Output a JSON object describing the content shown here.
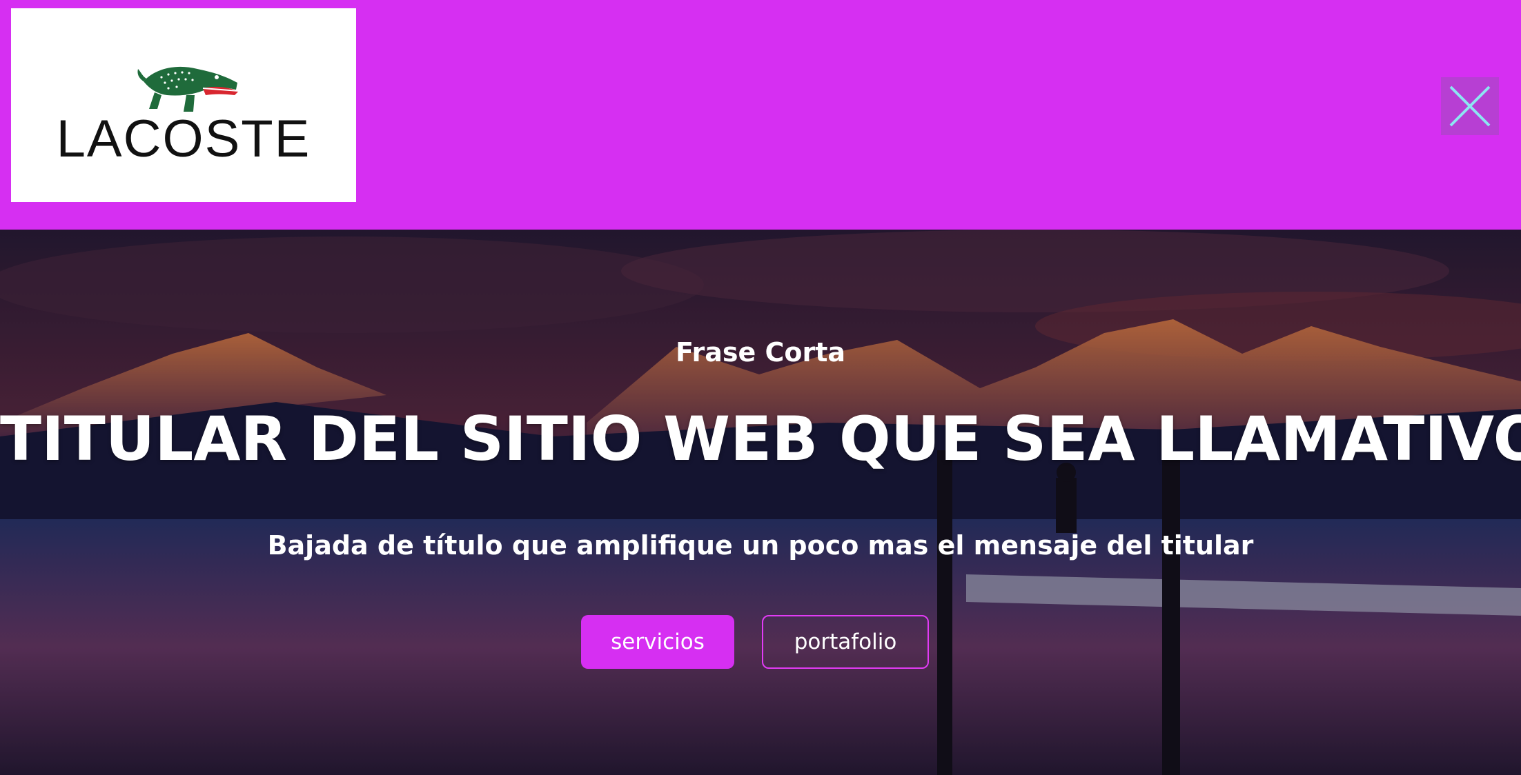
{
  "brand": {
    "name": "LACOSTE",
    "logo_icon": "crocodile-icon"
  },
  "header": {
    "close_icon": "close-icon",
    "bar_color": "#d62ff2",
    "close_color": "#8ce6f2"
  },
  "hero": {
    "eyebrow": "Frase Corta",
    "headline": "TITULAR DEL SITIO WEB QUE SEA LLAMATIVO",
    "subheadline": "Bajada de título que amplifique un poco mas el mensaje del titular",
    "buttons": {
      "primary_label": "servicios",
      "secondary_label": "portafolio"
    }
  },
  "colors": {
    "accent": "#d62ff2",
    "text": "#ffffff"
  }
}
